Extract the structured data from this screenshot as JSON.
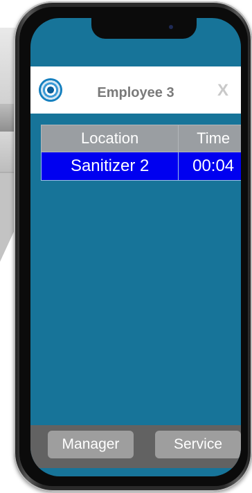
{
  "header": {
    "title": "Employee 3",
    "close_glyph": "X",
    "logo_icon": "target-logo-icon"
  },
  "table": {
    "columns": [
      "Location",
      "Time"
    ],
    "rows": [
      {
        "location": "Sanitizer 2",
        "time": "00:04"
      }
    ]
  },
  "footer": {
    "manager_label": "Manager",
    "service_label": "Service"
  },
  "colors": {
    "screen_bg": "#177499",
    "header_bg": "#ffffff",
    "table_header_bg": "#9a9ea2",
    "row_selected_bg": "#0000f0",
    "footer_bg": "#626262",
    "button_bg": "#9e9e9e"
  }
}
